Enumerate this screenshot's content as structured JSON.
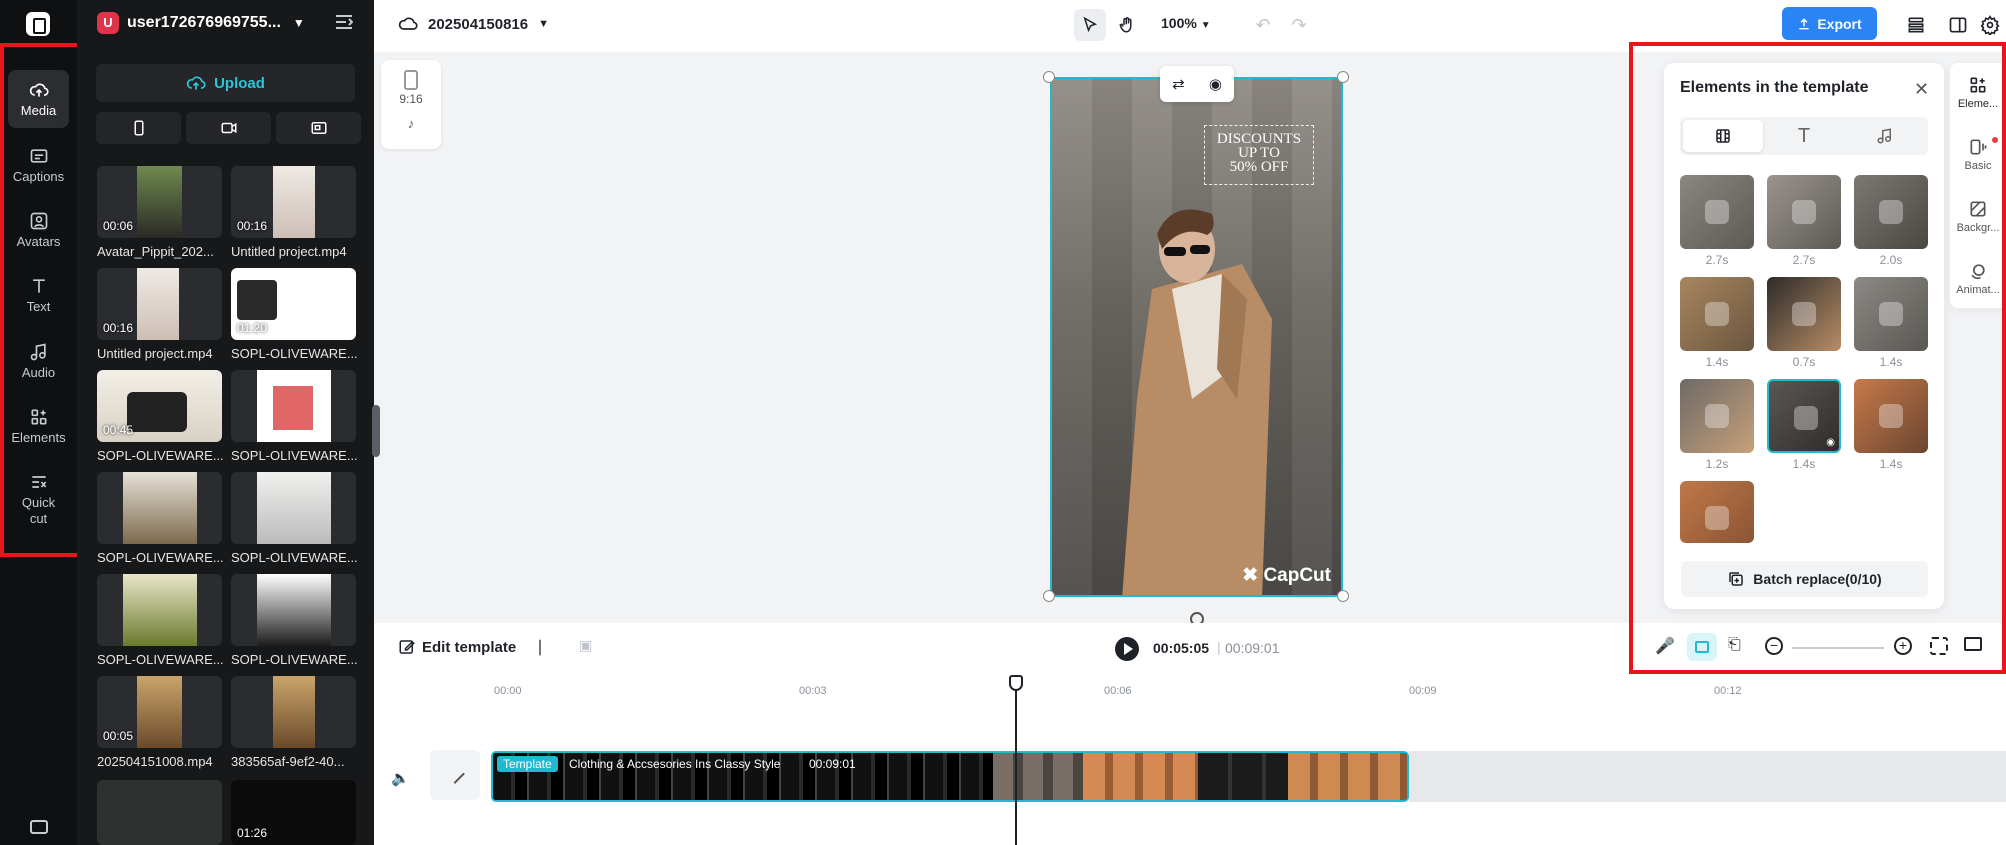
{
  "user": {
    "name": "user172676969755...",
    "avatar_letter": "U"
  },
  "rail": [
    {
      "label": "Media",
      "icon": "cloud-upload-icon",
      "active": true
    },
    {
      "label": "Captions",
      "icon": "captions-icon"
    },
    {
      "label": "Avatars",
      "icon": "avatar-icon"
    },
    {
      "label": "Text",
      "icon": "text-icon"
    },
    {
      "label": "Audio",
      "icon": "audio-icon"
    },
    {
      "label": "Elements",
      "icon": "elements-icon"
    },
    {
      "label": "Quick cut",
      "icon": "quick-cut-icon"
    }
  ],
  "media": {
    "upload_label": "Upload",
    "items": [
      {
        "name": "Avatar_Pippit_202...",
        "duration": "00:06"
      },
      {
        "name": "Untitled project.mp4",
        "duration": "00:16"
      },
      {
        "name": "Untitled project.mp4",
        "duration": "00:16"
      },
      {
        "name": "SOPL-OLIVEWARE...",
        "duration": "01:20"
      },
      {
        "name": "SOPL-OLIVEWARE...",
        "duration": "00:45"
      },
      {
        "name": "SOPL-OLIVEWARE...",
        "duration": ""
      },
      {
        "name": "SOPL-OLIVEWARE...",
        "duration": ""
      },
      {
        "name": "SOPL-OLIVEWARE...",
        "duration": ""
      },
      {
        "name": "SOPL-OLIVEWARE...",
        "duration": ""
      },
      {
        "name": "SOPL-OLIVEWARE...",
        "duration": ""
      },
      {
        "name": "202504151008.mp4",
        "duration": "00:05"
      },
      {
        "name": "383565af-9ef2-40...",
        "duration": ""
      },
      {
        "name": "",
        "duration": ""
      },
      {
        "name": "",
        "duration": "01:26"
      }
    ]
  },
  "topbar": {
    "project": "202504150816",
    "zoom": "100%",
    "export_label": "Export"
  },
  "canvas": {
    "ratio_label": "9:16",
    "overlay_text": [
      "DISCOUNTS",
      "UP TO",
      "50% OFF"
    ],
    "watermark": "CapCut"
  },
  "elements_panel": {
    "title": "Elements in the template",
    "durations": [
      "2.7s",
      "2.7s",
      "2.0s",
      "1.4s",
      "0.7s",
      "1.4s",
      "1.2s",
      "1.4s",
      "1.4s",
      ""
    ],
    "batch_label": "Batch replace(0/10)"
  },
  "right_tabs": [
    {
      "label": "Eleme...",
      "icon": "elements-icon"
    },
    {
      "label": "Basic",
      "icon": "basic-icon"
    },
    {
      "label": "Backgr...",
      "icon": "background-icon"
    },
    {
      "label": "Animat...",
      "icon": "animation-icon"
    }
  ],
  "timeline": {
    "edit_label": "Edit template",
    "current_time": "00:05:05",
    "total_time": "00:09:01",
    "ticks": [
      "00:00",
      "00:03",
      "00:06",
      "00:09",
      "00:12"
    ],
    "track_tag": "Template",
    "track_title": "Clothing & Accsesories Ins Classy Style",
    "track_duration": "00:09:01"
  }
}
